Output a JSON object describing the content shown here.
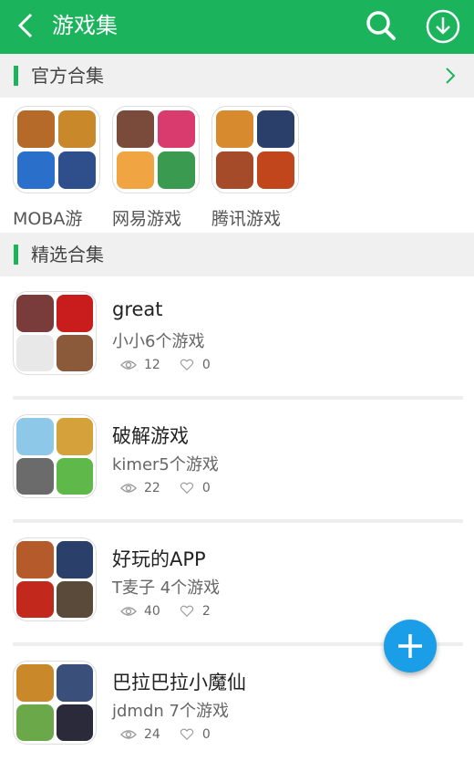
{
  "header": {
    "title": "游戏集"
  },
  "sections": {
    "official": "官方合集",
    "featured": "精选合集"
  },
  "official_collections": [
    {
      "label": "MOBA游",
      "tiles": [
        "#b56a2a",
        "#c9892b",
        "#2a6fc9",
        "#2f4f8c"
      ]
    },
    {
      "label": "网易游戏",
      "tiles": [
        "#7a4b3a",
        "#d93b6f",
        "#f0a542",
        "#3a9a4f"
      ]
    },
    {
      "label": "腾讯游戏",
      "tiles": [
        "#d88a2f",
        "#2a3f6a",
        "#a64b2a",
        "#c2461c"
      ]
    }
  ],
  "featured_collections": [
    {
      "title": "great",
      "subtitle": "小小6个游戏",
      "views": "12",
      "likes": "0",
      "tiles": [
        "#7a3b3b",
        "#c91d1d",
        "#e8e8e8",
        "#8a5a3a"
      ]
    },
    {
      "title": "破解游戏",
      "subtitle": "kimer5个游戏",
      "views": "22",
      "likes": "0",
      "tiles": [
        "#8ec8e8",
        "#d4a13a",
        "#6b6b6b",
        "#5fb84a"
      ]
    },
    {
      "title": "好玩的APP",
      "subtitle": "T麦子 4个游戏",
      "views": "40",
      "likes": "2",
      "tiles": [
        "#b55a2a",
        "#2a3f6a",
        "#c2281c",
        "#5a4a3a"
      ]
    },
    {
      "title": "巴拉巴拉小魔仙",
      "subtitle": "jdmdn 7个游戏",
      "views": "24",
      "likes": "0",
      "tiles": [
        "#c9892b",
        "#3a4f7a",
        "#6aa84a",
        "#2a2a3a"
      ]
    }
  ],
  "colors": {
    "brand": "#1bb35b",
    "fab": "#1b9ee8",
    "section_bg": "#f0f0f0"
  }
}
